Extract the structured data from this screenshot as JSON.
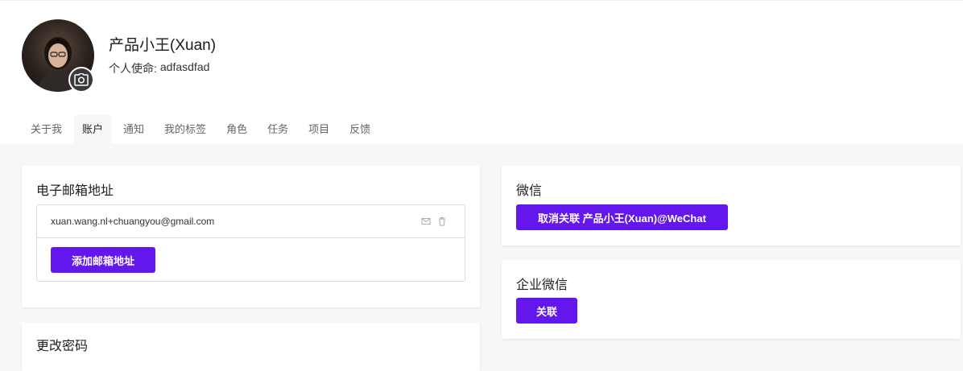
{
  "profile": {
    "name": "产品小王(Xuan)",
    "mission_label": "个人使命:",
    "mission_value": "adfasdfad"
  },
  "icons": {
    "camera": "camera-icon",
    "mail": "mail-icon",
    "trash": "trash-icon"
  },
  "tabs": [
    {
      "label": "关于我",
      "active": false
    },
    {
      "label": "账户",
      "active": true
    },
    {
      "label": "通知",
      "active": false
    },
    {
      "label": "我的标签",
      "active": false
    },
    {
      "label": "角色",
      "active": false
    },
    {
      "label": "任务",
      "active": false
    },
    {
      "label": "项目",
      "active": false
    },
    {
      "label": "反馈",
      "active": false
    }
  ],
  "email_section": {
    "title": "电子邮箱地址",
    "emails": [
      "xuan.wang.nl+chuangyou@gmail.com"
    ],
    "add_button": "添加邮箱地址"
  },
  "password_section": {
    "title": "更改密码"
  },
  "wechat_section": {
    "title": "微信",
    "unlink_button": "取消关联 产品小王(Xuan)@WeChat"
  },
  "enterprise_wechat_section": {
    "title": "企业微信",
    "link_button": "关联"
  },
  "colors": {
    "accent": "#6417ed",
    "background": "#f6f7f9"
  }
}
